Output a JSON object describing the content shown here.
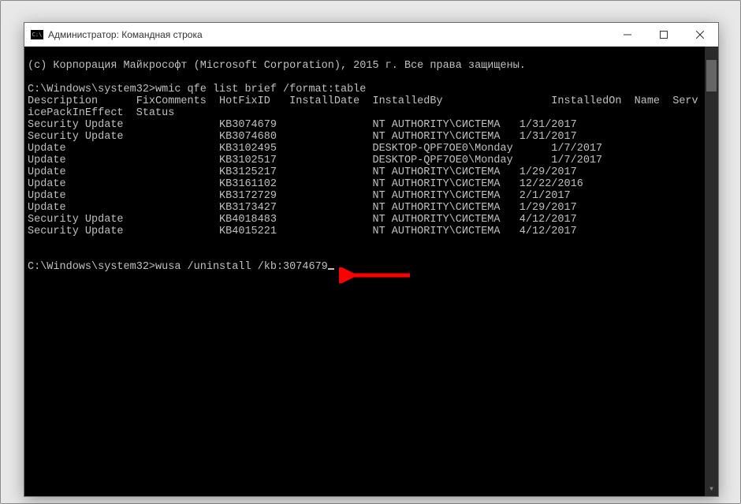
{
  "window": {
    "icon_text": "C:\\",
    "title": "Администратор: Командная строка"
  },
  "terminal": {
    "copyright": "(c) Корпорация Майкрософт (Microsoft Corporation), 2015 г. Все права защищены.",
    "blank1": "",
    "prompt1": "C:\\Windows\\system32>wmic qfe list brief /format:table",
    "header1": "Description      FixComments  HotFixID   InstallDate  InstalledBy                 InstalledOn  Name  Serv",
    "header2": "icePackInEffect  Status",
    "rows": [
      "Security Update               KB3074679               NT AUTHORITY\\СИСТЕМА   1/31/2017",
      "Security Update               KB3074680               NT AUTHORITY\\СИСТЕМА   1/31/2017",
      "Update                        KB3102495               DESKTOP-QPF7OE0\\Monday      1/7/2017",
      "Update                        KB3102517               DESKTOP-QPF7OE0\\Monday      1/7/2017",
      "Update                        KB3125217               NT AUTHORITY\\СИСТЕМА   1/29/2017",
      "Update                        KB3161102               NT AUTHORITY\\СИСТЕМА   12/22/2016",
      "Update                        KB3172729               NT AUTHORITY\\СИСТЕМА   2/1/2017",
      "Update                        KB3173427               NT AUTHORITY\\СИСТЕМА   1/29/2017",
      "Security Update               KB4018483               NT AUTHORITY\\СИСТЕМА   4/12/2017",
      "Security Update               KB4015221               NT AUTHORITY\\СИСТЕМА   4/12/2017"
    ],
    "blank2": "",
    "blank3": "",
    "prompt2_prefix": "C:\\Windows\\system32>",
    "prompt2_cmd": "wusa /uninstall /kb:3074679"
  }
}
